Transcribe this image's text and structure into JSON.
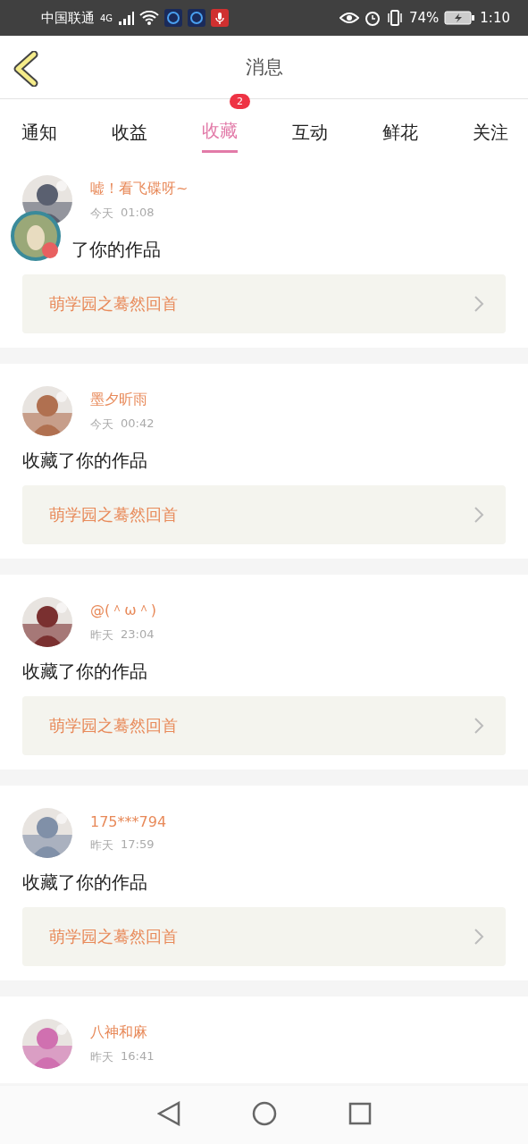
{
  "status_bar": {
    "carrier": "中国联通",
    "network": "4G",
    "battery": "74%",
    "time": "1:10"
  },
  "header": {
    "title": "消息"
  },
  "tabs": [
    {
      "label": "通知",
      "selected": false
    },
    {
      "label": "收益",
      "selected": false
    },
    {
      "label": "收藏",
      "selected": true,
      "badge": "2"
    },
    {
      "label": "互动",
      "selected": false
    },
    {
      "label": "鲜花",
      "selected": false
    },
    {
      "label": "关注",
      "selected": false
    }
  ],
  "messages": [
    {
      "name": "嘘！看飞碟呀~",
      "day": "今天",
      "time": "01:08",
      "text": "了你的作品",
      "work": "萌学园之蓦然回首",
      "floating_ball": true
    },
    {
      "name": "墨夕昕雨",
      "day": "今天",
      "time": "00:42",
      "text": "收藏了你的作品",
      "work": "萌学园之蓦然回首",
      "floating_ball": false
    },
    {
      "name": "@(＾ω＾)",
      "day": "昨天",
      "time": "23:04",
      "text": "收藏了你的作品",
      "work": "萌学园之蓦然回首",
      "floating_ball": false
    },
    {
      "name": "175***794",
      "day": "昨天",
      "time": "17:59",
      "text": "收藏了你的作品",
      "work": "萌学园之蓦然回首",
      "floating_ball": false
    },
    {
      "name": "八神和麻",
      "day": "昨天",
      "time": "16:41"
    }
  ]
}
